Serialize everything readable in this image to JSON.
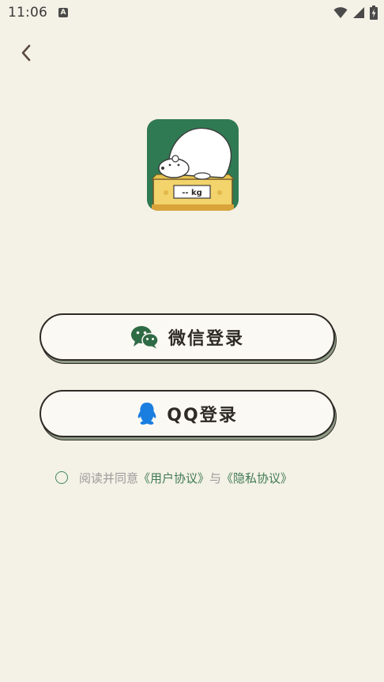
{
  "status_bar": {
    "time": "11:06",
    "notification_icon": "A"
  },
  "icons": {
    "back": "chevron-left-icon",
    "wifi": "wifi-icon",
    "signal": "signal-icon",
    "battery": "battery-charging-icon",
    "wechat": "wechat-icon",
    "qq": "qq-icon"
  },
  "logo": {
    "scale_text": "-- kg"
  },
  "buttons": {
    "wechat_label": "微信登录",
    "qq_label": "QQ登录"
  },
  "agreement": {
    "prefix": "阅读并同意",
    "user_agreement": "《用户协议》",
    "conjunction": "与",
    "privacy_policy": "《隐私协议》"
  },
  "colors": {
    "background": "#f4f1e6",
    "accent_green": "#3e7a52",
    "logo_green": "#2f7a52",
    "wechat_green": "#2f6b45",
    "qq_blue": "#1a7ee0",
    "button_shadow": "#8e9b86"
  }
}
